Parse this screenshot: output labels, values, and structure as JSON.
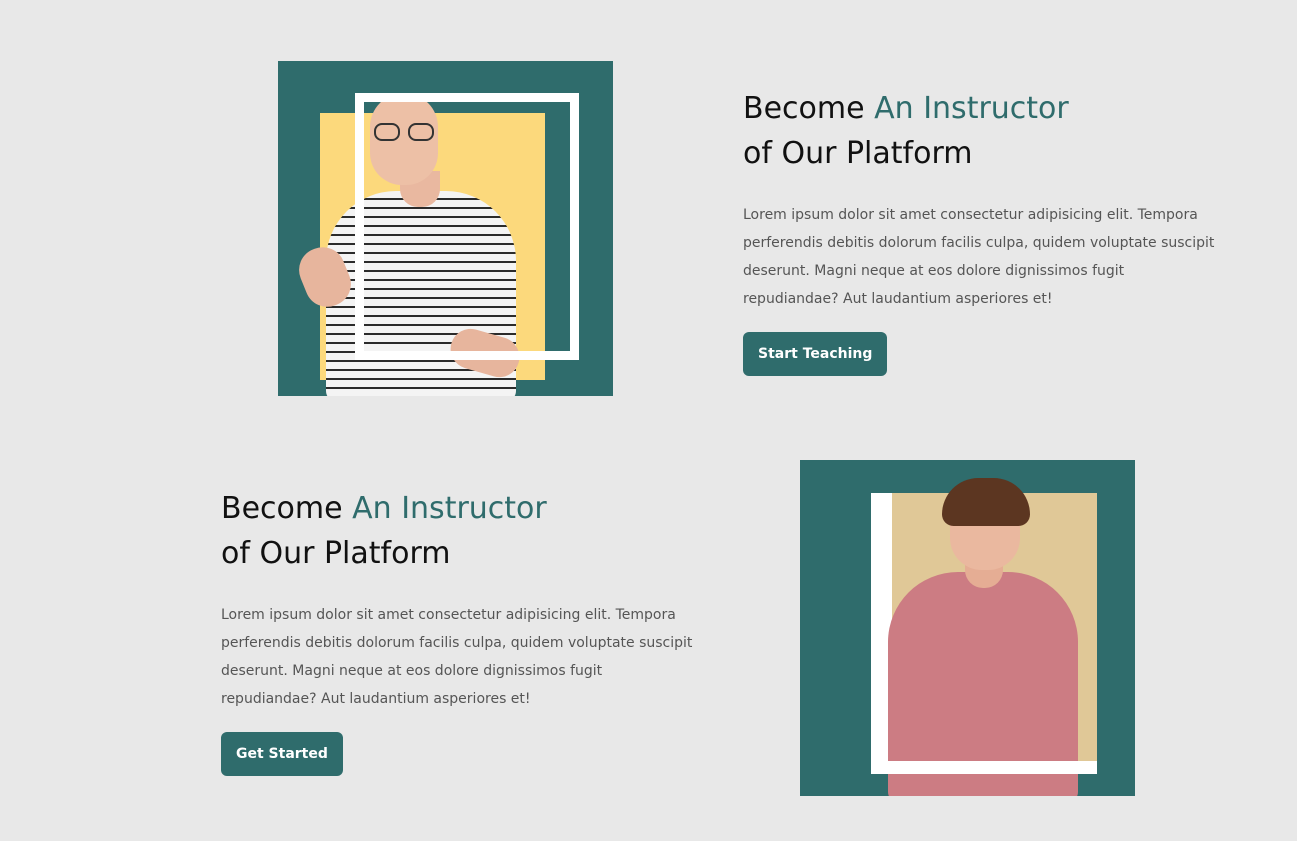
{
  "section_1": {
    "headline_prefix": "Become",
    "headline_accent": "An Instructor",
    "headline_line2": "of Our Platform",
    "body": "Lorem ipsum dolor sit amet consectetur adipisicing elit. Tempora perferendis debitis dolorum facilis culpa, quidem voluptate suscipit deserunt. Magni neque at eos dolore dignissimos fugit repudiandae? Aut laudantium asperiores et!",
    "button_label": "Start Teaching"
  },
  "section_2": {
    "headline_prefix": "Become",
    "headline_accent": "An Instructor",
    "headline_line2": "of Our Platform",
    "body": "Lorem ipsum dolor sit amet consectetur adipisicing elit. Tempora perferendis debitis dolorum facilis culpa, quidem voluptate suscipit deserunt. Magni neque at eos dolore dignissimos fugit repudiandae? Aut laudantium asperiores et!",
    "button_label": "Get Started"
  },
  "colors": {
    "accent": "#2f6c6c",
    "background": "#e8e8e8",
    "yellow": "#fcd97c",
    "beige": "#e0c897"
  }
}
